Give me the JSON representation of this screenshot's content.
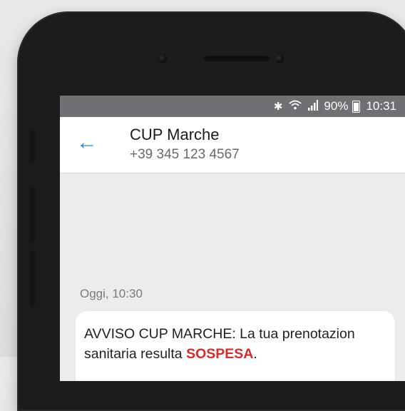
{
  "status_bar": {
    "bluetooth_icon": "bluetooth-icon",
    "wifi_icon": "wifi-icon",
    "signal_icon": "signal-icon",
    "battery_percent": "90%",
    "time": "10:31"
  },
  "header": {
    "back_icon": "arrow-left-icon",
    "contact_name": "CUP Marche",
    "contact_phone": "+39 345 123 4567"
  },
  "conversation": {
    "timestamp": "Oggi, 10:30",
    "messages": [
      {
        "text_part1": "AVVISO CUP MARCHE: La tua prenotazion sanitaria resulta ",
        "highlight": "SOSPESA",
        "text_part2": "."
      }
    ]
  },
  "colors": {
    "accent": "#2c8be6",
    "alert": "#d52b2b",
    "status_bar": "#6f7074"
  }
}
